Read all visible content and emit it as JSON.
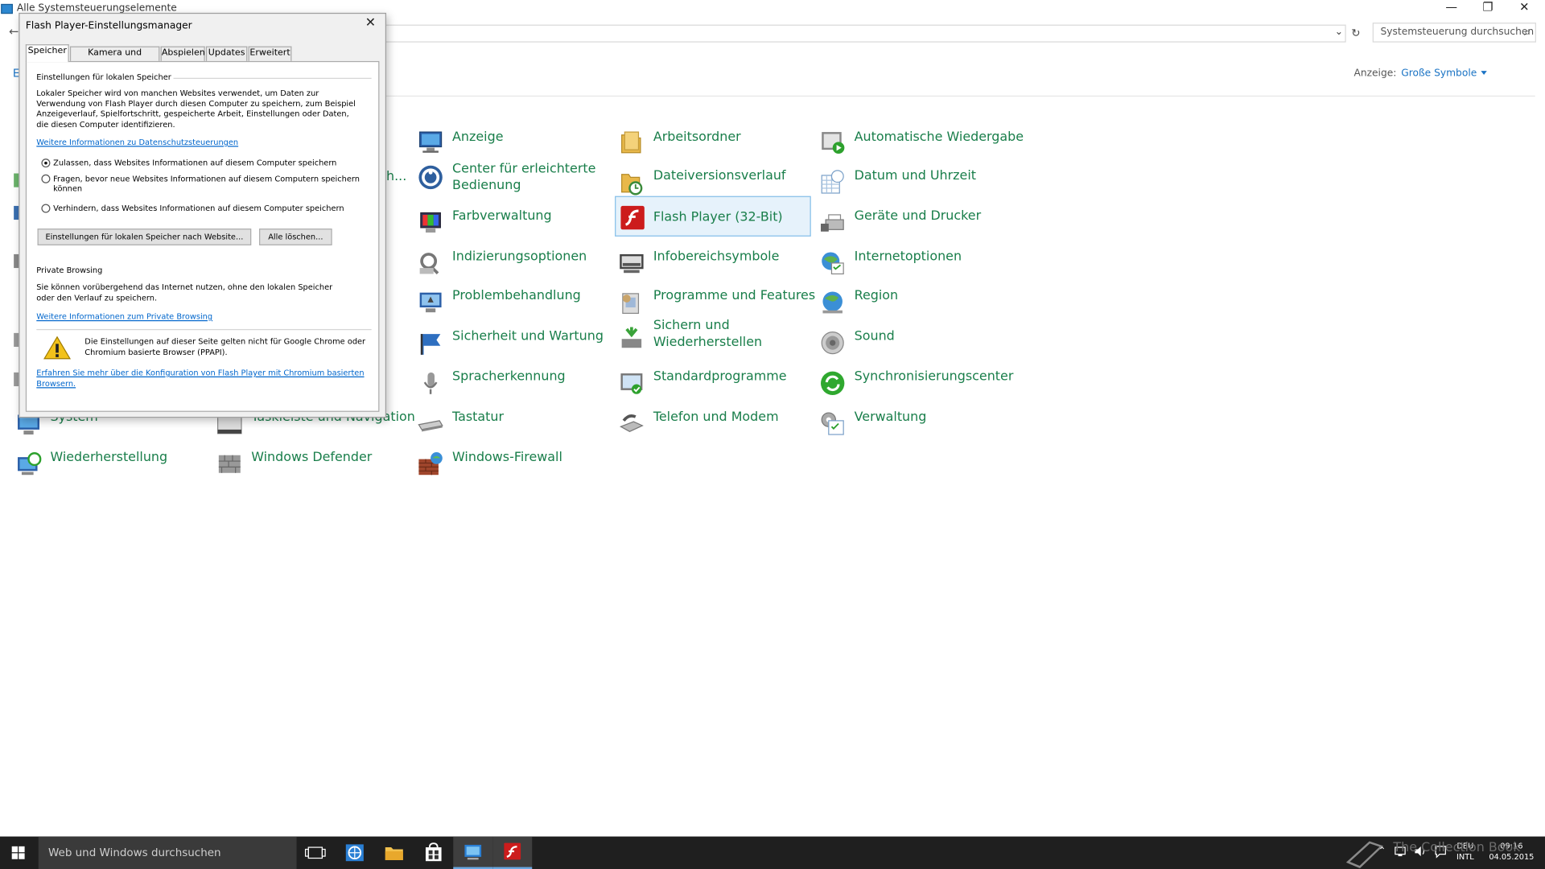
{
  "window": {
    "title": "Alle Systemsteuerungselemente",
    "back_label": "←",
    "breadcrumb_initial": "E",
    "search_placeholder": "Systemsteuerung durchsuchen",
    "view_label": "Anzeige:",
    "view_value": "Große Symbole"
  },
  "items": [
    {
      "label": "Anzeige",
      "icon": "display-icon"
    },
    {
      "label": "Arbeitsordner",
      "icon": "work-folders-icon"
    },
    {
      "label": "Automatische Wiedergabe",
      "icon": "autoplay-icon"
    },
    {
      "label": "Center für erleichterte",
      "label2": "Bedienung",
      "icon": "ease-of-access-icon"
    },
    {
      "label": "Dateiversionsverlauf",
      "icon": "file-history-icon"
    },
    {
      "label": "Datum und Uhrzeit",
      "icon": "date-time-icon"
    },
    {
      "label": "Farbverwaltung",
      "icon": "color-management-icon"
    },
    {
      "label": "Flash Player (32-Bit)",
      "icon": "flash-player-icon"
    },
    {
      "label": "Geräte und Drucker",
      "icon": "devices-printers-icon"
    },
    {
      "label": "Indizierungsoptionen",
      "icon": "indexing-icon"
    },
    {
      "label": "Infobereichsymbole",
      "icon": "notification-area-icon"
    },
    {
      "label": "Internetoptionen",
      "icon": "internet-options-icon"
    },
    {
      "label": "Problembehandlung",
      "icon": "troubleshooting-icon"
    },
    {
      "label": "Programme und Features",
      "icon": "programs-features-icon"
    },
    {
      "label": "Region",
      "icon": "region-icon"
    },
    {
      "label": "Sicherheit und Wartung",
      "icon": "security-maintenance-icon"
    },
    {
      "label": "Sichern und",
      "label2": "Wiederherstellen",
      "icon": "backup-restore-icon"
    },
    {
      "label": "Sound",
      "icon": "sound-icon"
    },
    {
      "label": "Spracherkennung",
      "icon": "speech-recognition-icon"
    },
    {
      "label": "Standardprogramme",
      "icon": "default-programs-icon"
    },
    {
      "label": "Synchronisierungscenter",
      "icon": "sync-center-icon"
    },
    {
      "label": "System",
      "icon": "system-icon"
    },
    {
      "label": "Taskleiste und Navigation",
      "icon": "taskbar-icon"
    },
    {
      "label": "Tastatur",
      "icon": "keyboard-icon"
    },
    {
      "label": "Telefon und Modem",
      "icon": "phone-modem-icon"
    },
    {
      "label": "Verwaltung",
      "icon": "administrative-tools-icon"
    },
    {
      "label": "Wiederherstellung",
      "icon": "recovery-icon"
    },
    {
      "label": "Windows Defender",
      "icon": "windows-defender-icon"
    },
    {
      "label": "Windows-Firewall",
      "icon": "windows-firewall-icon"
    }
  ],
  "partial_label": "h...",
  "dialog": {
    "title": "Flash Player-Einstellungsmanager",
    "tabs": [
      "Speicher",
      "Kamera und Mikrofon",
      "Abspielen",
      "Updates",
      "Erweitert"
    ],
    "local_heading": "Einstellungen für lokalen Speicher",
    "local_desc": [
      "Lokaler Speicher wird von manchen Websites verwendet, um Daten zur",
      "Verwendung von Flash Player durch diesen Computer zu speichern, zum Beispiel",
      "Anzeigeverlauf, Spielfortschritt, gespeicherte Arbeit, Einstellungen oder Daten,",
      "die diesen Computer identifizieren."
    ],
    "privacy_link": "Weitere Informationen zu Datenschutzsteuerungen",
    "radio_allow": "Zulassen, dass Websites Informationen auf diesem Computer speichern",
    "radio_ask_1": "Fragen, bevor neue Websites Informationen auf diesem Computern speichern",
    "radio_ask_2": "können",
    "radio_block": "Verhindern, dass Websites Informationen auf diesem Computer speichern",
    "btn_per_site": "Einstellungen für lokalen Speicher  nach Website...",
    "btn_delete_all": "Alle löschen...",
    "private_heading": "Private Browsing",
    "private_desc_1": "Sie können vorübergehend das Internet nutzen, ohne den lokalen Speicher",
    "private_desc_2": "oder den Verlauf zu speichern.",
    "private_link": "Weitere Informationen zum Private Browsing",
    "warning_1": "Die Einstellungen auf dieser Seite gelten nicht für Google Chrome oder",
    "warning_2": "Chromium basierte Browser (PPAPI).",
    "chromium_link_1": "Erfahren Sie mehr über die Konfiguration von Flash Player mit Chromium basierten",
    "chromium_link_2": "Browsern."
  },
  "taskbar": {
    "search_placeholder": "Web und Windows durchsuchen",
    "lang_1": "DEU",
    "lang_2": "INTL",
    "time": "09:16",
    "date": "04.05.2015",
    "watermark": "The Collection Book"
  }
}
